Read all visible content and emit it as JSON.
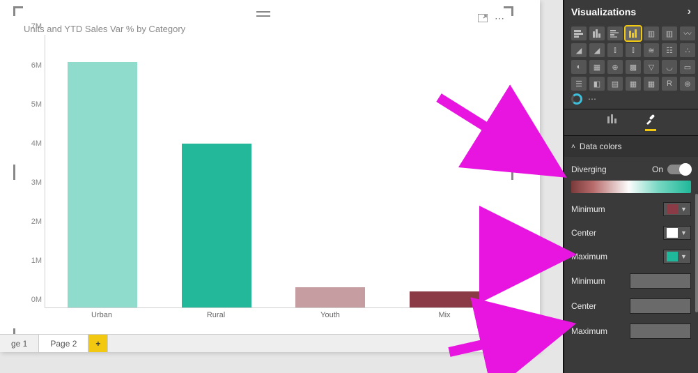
{
  "canvas": {
    "chart_title": "Units and YTD Sales Var % by Category",
    "focus_tooltip": "Focus mode",
    "more_tooltip": "More options"
  },
  "chart_data": {
    "type": "bar",
    "title": "Units and YTD Sales Var % by Category",
    "categories": [
      "Urban",
      "Rural",
      "Youth",
      "Mix"
    ],
    "values": [
      6300000,
      4200000,
      520000,
      420000
    ],
    "colors": [
      "#8fdccd",
      "#23b89a",
      "#c69da1",
      "#8a3b45"
    ],
    "ylim": [
      0,
      7000000
    ],
    "ytick_labels": [
      "0M",
      "1M",
      "2M",
      "3M",
      "4M",
      "5M",
      "6M",
      "7M"
    ],
    "xlabel": "",
    "ylabel": ""
  },
  "tabs": {
    "page1": "ge 1",
    "page2": "Page 2",
    "add": "+"
  },
  "viz_pane": {
    "title": "Visualizations",
    "fields_tab": "Fields",
    "format_tab": "Format",
    "section": "Data colors",
    "diverging_label": "Diverging",
    "diverging_state": "On",
    "min_label": "Minimum",
    "center_label": "Center",
    "max_label": "Maximum",
    "min_num_label": "Minimum",
    "center_num_label": "Center",
    "max_num_label": "Maximum",
    "color_min": "#8a3b45",
    "color_center": "#ffffff",
    "color_max": "#1fb89a"
  }
}
